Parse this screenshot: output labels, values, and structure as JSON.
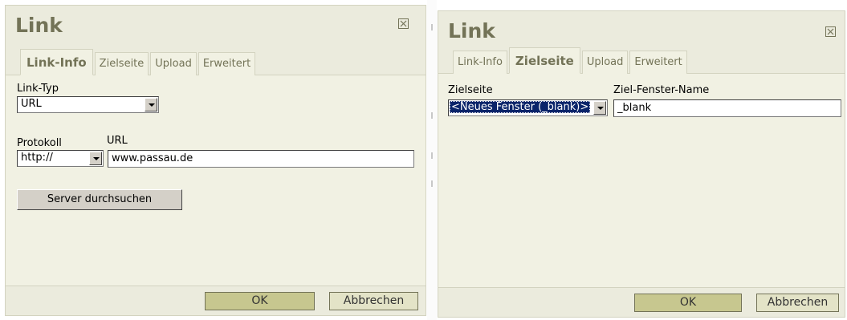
{
  "left_dialog": {
    "title": "Link",
    "tabs": [
      {
        "label": "Link-Info",
        "active": true
      },
      {
        "label": "Zielseite",
        "active": false
      },
      {
        "label": "Upload",
        "active": false
      },
      {
        "label": "Erweitert",
        "active": false
      }
    ],
    "link_type": {
      "label": "Link-Typ",
      "value": "URL"
    },
    "protocol": {
      "label": "Protokoll",
      "value": "http://"
    },
    "url": {
      "label": "URL",
      "value": "www.passau.de"
    },
    "browse_button": "Server durchsuchen",
    "ok_label": "OK",
    "cancel_label": "Abbrechen"
  },
  "right_dialog": {
    "title": "Link",
    "tabs": [
      {
        "label": "Link-Info",
        "active": false
      },
      {
        "label": "Zielseite",
        "active": true
      },
      {
        "label": "Upload",
        "active": false
      },
      {
        "label": "Erweitert",
        "active": false
      }
    ],
    "target": {
      "label": "Zielseite",
      "value": "<Neues Fenster (_blank)>"
    },
    "target_name": {
      "label": "Ziel-Fenster-Name",
      "value": "_blank"
    },
    "ok_label": "OK",
    "cancel_label": "Abbrechen"
  },
  "icons": {
    "close": "close-x-icon",
    "dropdown": "chevron-down-icon"
  },
  "colors": {
    "dialog_bg": "#f1f1e3",
    "header_bg": "#ebebdd",
    "accent_text": "#737357",
    "ok_button": "#c7c78f",
    "cancel_button": "#e3e3c7",
    "selection": "#0a246a"
  }
}
